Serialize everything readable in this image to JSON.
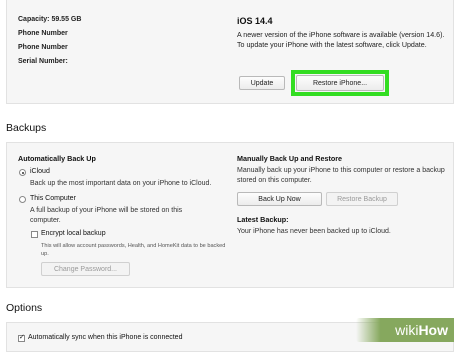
{
  "summary": {
    "capacity_label": "Capacity: 59.55 GB",
    "phone1_label": "Phone Number",
    "phone2_label": "Phone Number",
    "serial_label": "Serial Number:",
    "ios_version": "iOS 14.4",
    "ios_desc": "A newer version of the iPhone software is available (version 14.6). To update your iPhone with the latest software, click Update.",
    "update_button": "Update",
    "restore_button": "Restore iPhone..."
  },
  "backups": {
    "title": "Backups",
    "auto_heading": "Automatically Back Up",
    "icloud_label": "iCloud",
    "icloud_desc": "Back up the most important data on your iPhone to iCloud.",
    "computer_label": "This Computer",
    "computer_desc": "A full backup of your iPhone will be stored on this computer.",
    "encrypt_label": "Encrypt local backup",
    "encrypt_desc": "This will allow account passwords, Health, and HomeKit data to be backed up.",
    "change_password_button": "Change Password...",
    "manual_heading": "Manually Back Up and Restore",
    "manual_desc": "Manually back up your iPhone to this computer or restore a backup stored on this computer.",
    "back_up_now_button": "Back Up Now",
    "restore_backup_button": "Restore Backup",
    "latest_heading": "Latest Backup:",
    "latest_desc": "Your iPhone has never been backed up to iCloud."
  },
  "options": {
    "title": "Options",
    "auto_sync_label": "Automatically sync when this iPhone is connected"
  },
  "watermark": {
    "wiki": "wiki",
    "how": "How"
  },
  "colors": {
    "highlight": "#33dd22",
    "panel_bg": "#f6f6f6"
  }
}
